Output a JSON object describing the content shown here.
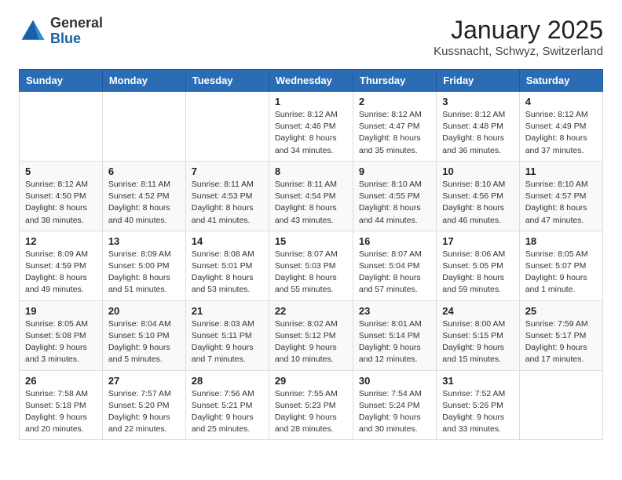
{
  "header": {
    "logo_general": "General",
    "logo_blue": "Blue",
    "month": "January 2025",
    "location": "Kussnacht, Schwyz, Switzerland"
  },
  "weekdays": [
    "Sunday",
    "Monday",
    "Tuesday",
    "Wednesday",
    "Thursday",
    "Friday",
    "Saturday"
  ],
  "weeks": [
    [
      {
        "day": "",
        "info": ""
      },
      {
        "day": "",
        "info": ""
      },
      {
        "day": "",
        "info": ""
      },
      {
        "day": "1",
        "info": "Sunrise: 8:12 AM\nSunset: 4:46 PM\nDaylight: 8 hours\nand 34 minutes."
      },
      {
        "day": "2",
        "info": "Sunrise: 8:12 AM\nSunset: 4:47 PM\nDaylight: 8 hours\nand 35 minutes."
      },
      {
        "day": "3",
        "info": "Sunrise: 8:12 AM\nSunset: 4:48 PM\nDaylight: 8 hours\nand 36 minutes."
      },
      {
        "day": "4",
        "info": "Sunrise: 8:12 AM\nSunset: 4:49 PM\nDaylight: 8 hours\nand 37 minutes."
      }
    ],
    [
      {
        "day": "5",
        "info": "Sunrise: 8:12 AM\nSunset: 4:50 PM\nDaylight: 8 hours\nand 38 minutes."
      },
      {
        "day": "6",
        "info": "Sunrise: 8:11 AM\nSunset: 4:52 PM\nDaylight: 8 hours\nand 40 minutes."
      },
      {
        "day": "7",
        "info": "Sunrise: 8:11 AM\nSunset: 4:53 PM\nDaylight: 8 hours\nand 41 minutes."
      },
      {
        "day": "8",
        "info": "Sunrise: 8:11 AM\nSunset: 4:54 PM\nDaylight: 8 hours\nand 43 minutes."
      },
      {
        "day": "9",
        "info": "Sunrise: 8:10 AM\nSunset: 4:55 PM\nDaylight: 8 hours\nand 44 minutes."
      },
      {
        "day": "10",
        "info": "Sunrise: 8:10 AM\nSunset: 4:56 PM\nDaylight: 8 hours\nand 46 minutes."
      },
      {
        "day": "11",
        "info": "Sunrise: 8:10 AM\nSunset: 4:57 PM\nDaylight: 8 hours\nand 47 minutes."
      }
    ],
    [
      {
        "day": "12",
        "info": "Sunrise: 8:09 AM\nSunset: 4:59 PM\nDaylight: 8 hours\nand 49 minutes."
      },
      {
        "day": "13",
        "info": "Sunrise: 8:09 AM\nSunset: 5:00 PM\nDaylight: 8 hours\nand 51 minutes."
      },
      {
        "day": "14",
        "info": "Sunrise: 8:08 AM\nSunset: 5:01 PM\nDaylight: 8 hours\nand 53 minutes."
      },
      {
        "day": "15",
        "info": "Sunrise: 8:07 AM\nSunset: 5:03 PM\nDaylight: 8 hours\nand 55 minutes."
      },
      {
        "day": "16",
        "info": "Sunrise: 8:07 AM\nSunset: 5:04 PM\nDaylight: 8 hours\nand 57 minutes."
      },
      {
        "day": "17",
        "info": "Sunrise: 8:06 AM\nSunset: 5:05 PM\nDaylight: 8 hours\nand 59 minutes."
      },
      {
        "day": "18",
        "info": "Sunrise: 8:05 AM\nSunset: 5:07 PM\nDaylight: 9 hours\nand 1 minute."
      }
    ],
    [
      {
        "day": "19",
        "info": "Sunrise: 8:05 AM\nSunset: 5:08 PM\nDaylight: 9 hours\nand 3 minutes."
      },
      {
        "day": "20",
        "info": "Sunrise: 8:04 AM\nSunset: 5:10 PM\nDaylight: 9 hours\nand 5 minutes."
      },
      {
        "day": "21",
        "info": "Sunrise: 8:03 AM\nSunset: 5:11 PM\nDaylight: 9 hours\nand 7 minutes."
      },
      {
        "day": "22",
        "info": "Sunrise: 8:02 AM\nSunset: 5:12 PM\nDaylight: 9 hours\nand 10 minutes."
      },
      {
        "day": "23",
        "info": "Sunrise: 8:01 AM\nSunset: 5:14 PM\nDaylight: 9 hours\nand 12 minutes."
      },
      {
        "day": "24",
        "info": "Sunrise: 8:00 AM\nSunset: 5:15 PM\nDaylight: 9 hours\nand 15 minutes."
      },
      {
        "day": "25",
        "info": "Sunrise: 7:59 AM\nSunset: 5:17 PM\nDaylight: 9 hours\nand 17 minutes."
      }
    ],
    [
      {
        "day": "26",
        "info": "Sunrise: 7:58 AM\nSunset: 5:18 PM\nDaylight: 9 hours\nand 20 minutes."
      },
      {
        "day": "27",
        "info": "Sunrise: 7:57 AM\nSunset: 5:20 PM\nDaylight: 9 hours\nand 22 minutes."
      },
      {
        "day": "28",
        "info": "Sunrise: 7:56 AM\nSunset: 5:21 PM\nDaylight: 9 hours\nand 25 minutes."
      },
      {
        "day": "29",
        "info": "Sunrise: 7:55 AM\nSunset: 5:23 PM\nDaylight: 9 hours\nand 28 minutes."
      },
      {
        "day": "30",
        "info": "Sunrise: 7:54 AM\nSunset: 5:24 PM\nDaylight: 9 hours\nand 30 minutes."
      },
      {
        "day": "31",
        "info": "Sunrise: 7:52 AM\nSunset: 5:26 PM\nDaylight: 9 hours\nand 33 minutes."
      },
      {
        "day": "",
        "info": ""
      }
    ]
  ]
}
